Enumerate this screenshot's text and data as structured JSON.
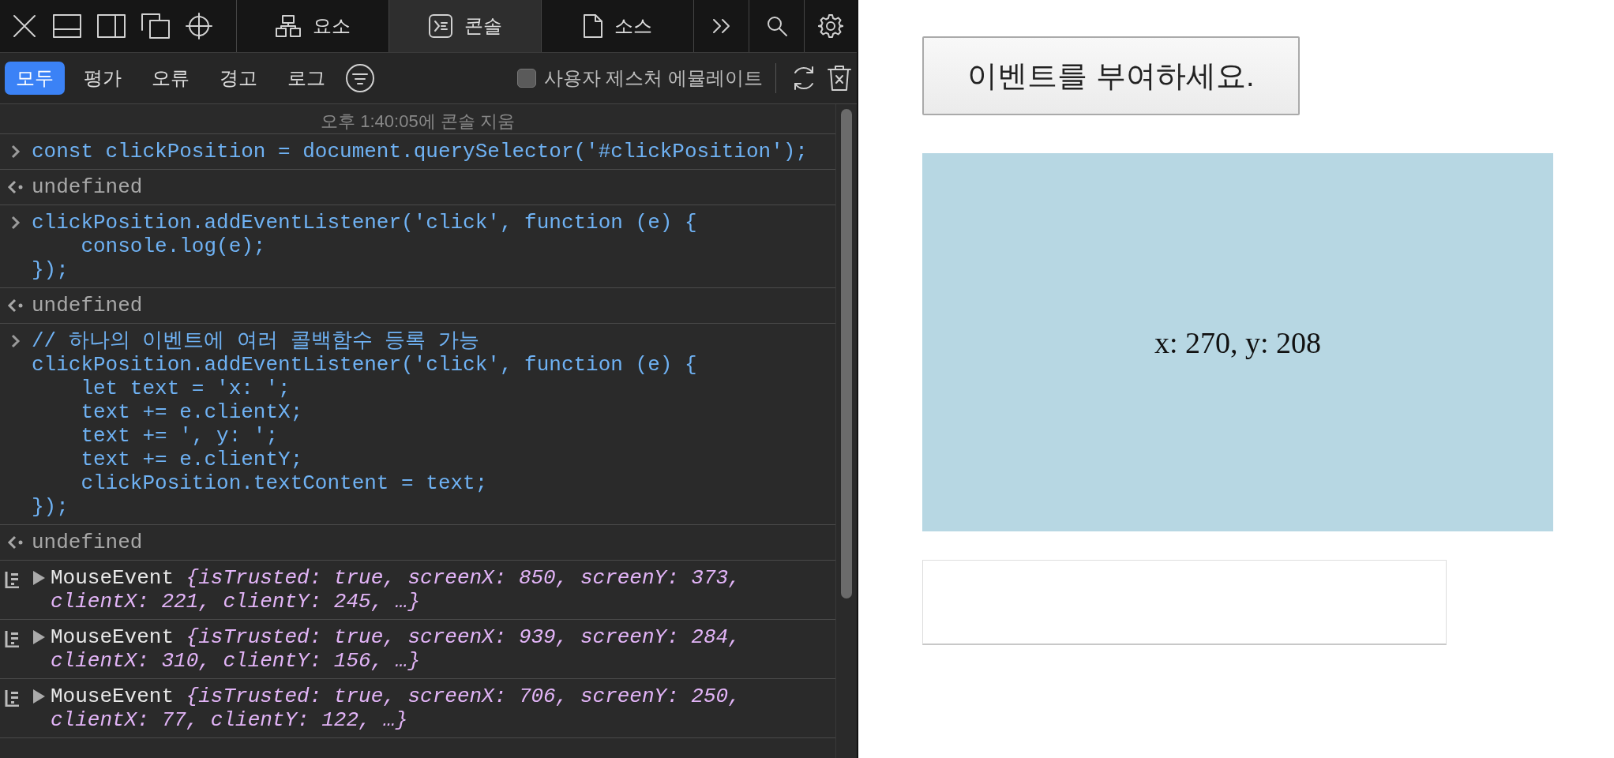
{
  "devtools": {
    "tabs": [
      {
        "kind": "elements",
        "label": "요소",
        "selected": false
      },
      {
        "kind": "console",
        "label": "콘솔",
        "selected": true
      },
      {
        "kind": "sources",
        "label": "소스",
        "selected": false
      }
    ],
    "filters": [
      {
        "label": "모두",
        "selected": true
      },
      {
        "label": "평가",
        "selected": false
      },
      {
        "label": "오류",
        "selected": false
      },
      {
        "label": "경고",
        "selected": false
      },
      {
        "label": "로그",
        "selected": false
      }
    ],
    "emulate_gesture": {
      "label": "사용자 제스처 에뮬레이트",
      "checked": false
    },
    "cleared_message": "오후 1:40:05에 콘솔 지움",
    "entries": [
      {
        "kind": "input",
        "code": "const clickPosition = document.querySelector('#clickPosition');"
      },
      {
        "kind": "output",
        "text": "undefined"
      },
      {
        "kind": "input",
        "code": "clickPosition.addEventListener('click', function (e) {\n    console.log(e);\n});"
      },
      {
        "kind": "output",
        "text": "undefined"
      },
      {
        "kind": "input",
        "code": "// 하나의 이벤트에 여러 콜백함수 등록 가능\nclickPosition.addEventListener('click', function (e) {\n    let text = 'x: ';\n    text += e.clientX;\n    text += ', y: ';\n    text += e.clientY;\n    clickPosition.textContent = text;\n});"
      },
      {
        "kind": "output",
        "text": "undefined"
      },
      {
        "kind": "log",
        "expanded": false,
        "name": "MouseEvent",
        "summary": "{isTrusted: true, screenX: 850, screenY: 373, clientX: 221, clientY: 245, …}"
      },
      {
        "kind": "log",
        "expanded": false,
        "name": "MouseEvent",
        "summary": "{isTrusted: true, screenX: 939, screenY: 284, clientX: 310, clientY: 156, …}"
      },
      {
        "kind": "log",
        "expanded": false,
        "name": "MouseEvent",
        "summary": "{isTrusted: true, screenX: 706, screenY: 250, clientX: 77, clientY: 122, …}"
      }
    ]
  },
  "page": {
    "button": {
      "label": "이벤트를 부여하세요."
    },
    "click_area": {
      "text": "x: 270, y: 208"
    }
  }
}
